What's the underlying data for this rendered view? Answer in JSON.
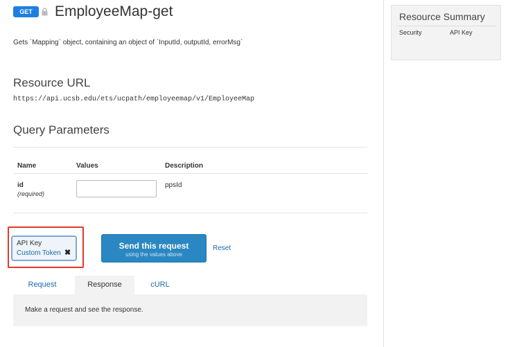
{
  "header": {
    "method": "GET",
    "title": "EmployeeMap-get",
    "description": "Gets `Mapping` object, containing an object of `InputId, outputId, errorMsg`"
  },
  "resource_url": {
    "heading": "Resource URL",
    "url": "https://api.ucsb.edu/ets/ucpath/employeemap/v1/EmployeeMap"
  },
  "query_params": {
    "heading": "Query Parameters",
    "columns": [
      "Name",
      "Values",
      "Description"
    ],
    "rows": [
      {
        "name": "id",
        "required": "(required)",
        "value": "",
        "description": "ppsId"
      }
    ]
  },
  "auth": {
    "label": "API Key",
    "value": "Custom Token"
  },
  "actions": {
    "send_label": "Send this request",
    "send_sub": "using the values above",
    "reset_label": "Reset"
  },
  "tabs": [
    {
      "label": "Request"
    },
    {
      "label": "Response"
    },
    {
      "label": "cURL"
    }
  ],
  "active_tab": "Response",
  "response": {
    "message": "Make a request and see the response."
  },
  "summary": {
    "title": "Resource Summary",
    "rows": [
      {
        "key": "Security",
        "value": "API Key"
      }
    ]
  },
  "colors": {
    "accent": "#1f7fe0",
    "button": "#2a87c2",
    "link": "#1a6aad",
    "highlight": "#e5372b"
  },
  "icons": {
    "lock": "lock-icon",
    "close": "close-icon"
  }
}
